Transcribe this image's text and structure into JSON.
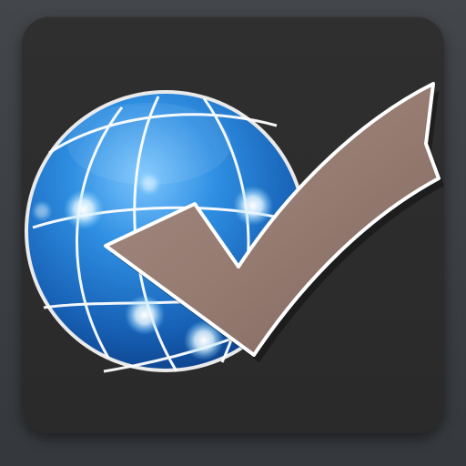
{
  "app_icon": {
    "icon_name": "globe-checkmark-icon",
    "colors": {
      "background_tile": "#2d2d2d",
      "globe_blue": "#1f78d1",
      "globe_highlight": "#7cc6ff",
      "grid_lines": "#ffffff",
      "checkmark_fill": "#9a7f76",
      "checkmark_outline": "#ffffff"
    }
  }
}
